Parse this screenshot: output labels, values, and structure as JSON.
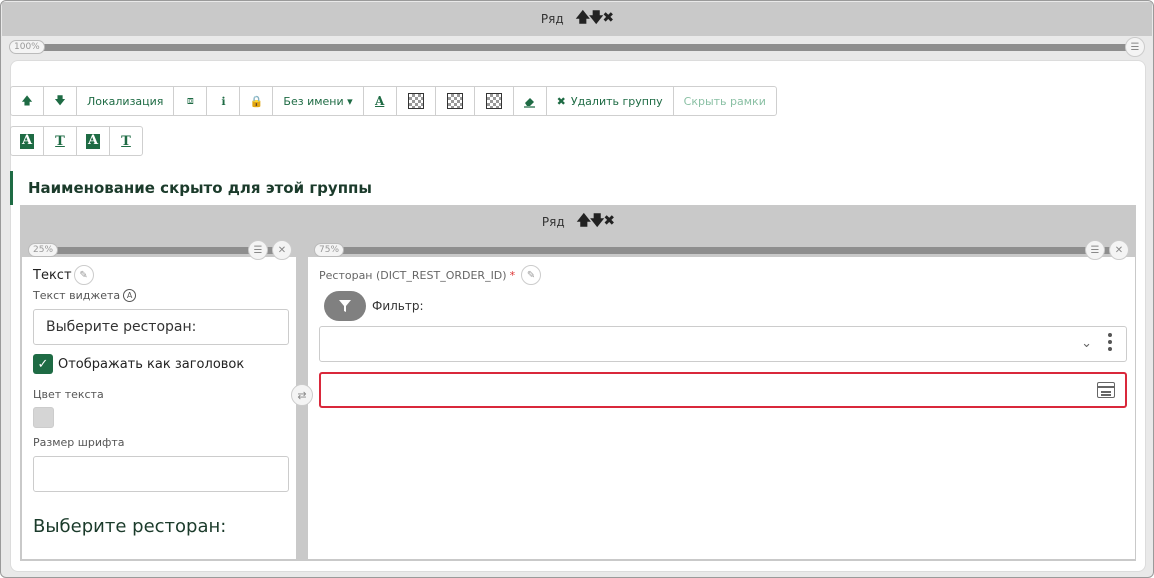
{
  "outer_row": {
    "label": "Ряд",
    "arrows": "🡅🡇✖",
    "width_pct": "100%"
  },
  "toolbar1": {
    "up": "🡅",
    "down": "🡇",
    "localization": "Локализация",
    "binoculars": "⧈",
    "info": "ℹ",
    "lock": "🔒",
    "name_dropdown": "Без имени ▾",
    "font_color": "A",
    "delete_group": "Удалить группу",
    "delete_x": "✖",
    "hide_frames": "Скрыть рамки"
  },
  "toolbar2": {
    "b1": "A",
    "b2": "T",
    "b3": "A",
    "b4": "T"
  },
  "group_title": "Наименование скрыто для этой группы",
  "inner_row": {
    "label": "Ряд",
    "arrows": "🡅🡇✖"
  },
  "left_col": {
    "pct": "25%",
    "title": "Текст",
    "subtitle": "Текст виджета",
    "a_badge": "A",
    "widget_text": "Выберите ресторан:",
    "show_as_header": "Отображать как заголовок",
    "check": "✓",
    "text_color_label": "Цвет текста",
    "font_size_label": "Размер шрифта",
    "font_size_value": "",
    "preview_text": "Выберите ресторан:"
  },
  "right_col": {
    "pct": "75%",
    "title": "Ресторан (DICT_REST_ORDER_ID)",
    "required_mark": "*",
    "filter_label": "Фильтр:",
    "chevron": "⌄"
  },
  "icons": {
    "edit": "✎",
    "close": "✕",
    "menu": "☰",
    "swap": "⇄"
  }
}
